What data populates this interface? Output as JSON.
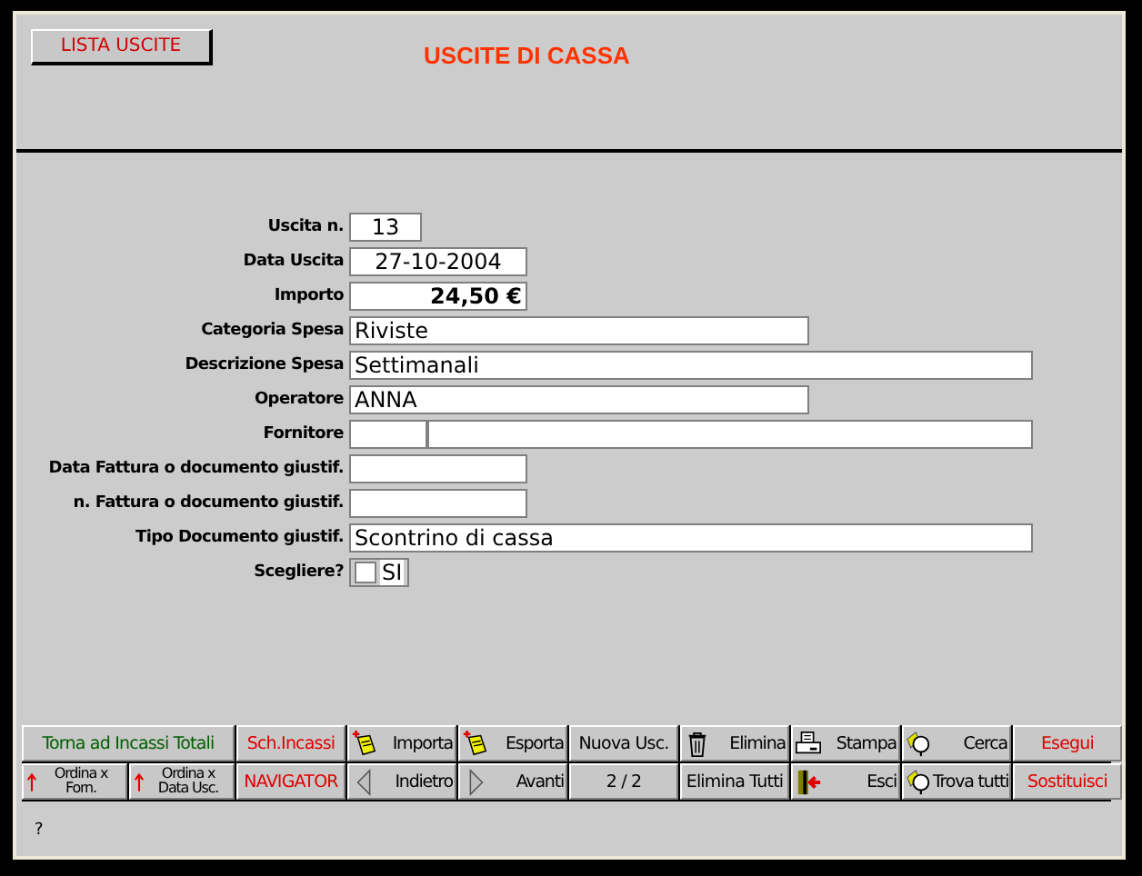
{
  "header": {
    "list_button": "LISTA USCITE",
    "title": "USCITE DI CASSA"
  },
  "fields": [
    {
      "label": "Uscita n.",
      "kind": "number",
      "value": "13"
    },
    {
      "label": "Data  Uscita",
      "kind": "date",
      "value": "27-10-2004"
    },
    {
      "label": "Importo",
      "kind": "amount",
      "value": "24,50 €"
    },
    {
      "label": "Categoria Spesa",
      "kind": "text",
      "value": "Riviste"
    },
    {
      "label": "Descrizione Spesa",
      "kind": "wide",
      "value": "Settimanali"
    },
    {
      "label": "Operatore",
      "kind": "text",
      "value": "ANNA"
    },
    {
      "label": "Fornitore",
      "kind": "split"
    },
    {
      "label": "Data  Fattura o documento giustif.",
      "kind": "date"
    },
    {
      "label": "n. Fattura o documento giustif.",
      "kind": "date"
    },
    {
      "label": "Tipo Documento giustif.",
      "kind": "wide",
      "value": "Scontrino di cassa"
    },
    {
      "label": "Scegliere?",
      "kind": "checkbox",
      "checked": false,
      "value": "SI"
    }
  ],
  "toolbar": [
    {
      "label": "Torna ad Incassi Totali",
      "kind": "wide",
      "color": "#006000"
    },
    {
      "label": "Sch.Incassi",
      "kind": "plain",
      "color": "#e00000"
    },
    {
      "label": "Importa",
      "kind": "import",
      "color": "#000000"
    },
    {
      "label": "Esporta",
      "kind": "export",
      "color": "#000000"
    },
    {
      "label": "Nuova Usc.",
      "kind": "plain",
      "color": "#000000"
    },
    {
      "label": "Elimina",
      "kind": "trash",
      "color": "#000000"
    },
    {
      "label": "Stampa",
      "kind": "print",
      "color": "#000000"
    },
    {
      "label": "Cerca",
      "kind": "search",
      "color": "#000000"
    },
    {
      "label": "Esegui",
      "kind": "plain",
      "color": "#e00000"
    },
    {
      "label": "Ordina x Forn.",
      "kind": "sort-az",
      "color": "#000000"
    },
    {
      "label": "Ordina x Data Usc.",
      "kind": "sort",
      "color": "#000000"
    },
    {
      "label": "NAVIGATOR",
      "kind": "plain",
      "color": "#e00000"
    },
    {
      "label": "Indietro",
      "kind": "prev",
      "color": "#000000"
    },
    {
      "label": "Avanti",
      "kind": "next",
      "color": "#000000"
    },
    {
      "label": "2 / 2",
      "kind": "plain",
      "color": "#000000"
    },
    {
      "label": "Elimina Tutti",
      "kind": "plain",
      "color": "#000000"
    },
    {
      "label": "Esci",
      "kind": "exit",
      "color": "#000000"
    },
    {
      "label": "Trova tutti",
      "kind": "search",
      "color": "#000000"
    },
    {
      "label": "Sostituisci",
      "kind": "plain",
      "color": "#e00000"
    }
  ],
  "status": "?"
}
